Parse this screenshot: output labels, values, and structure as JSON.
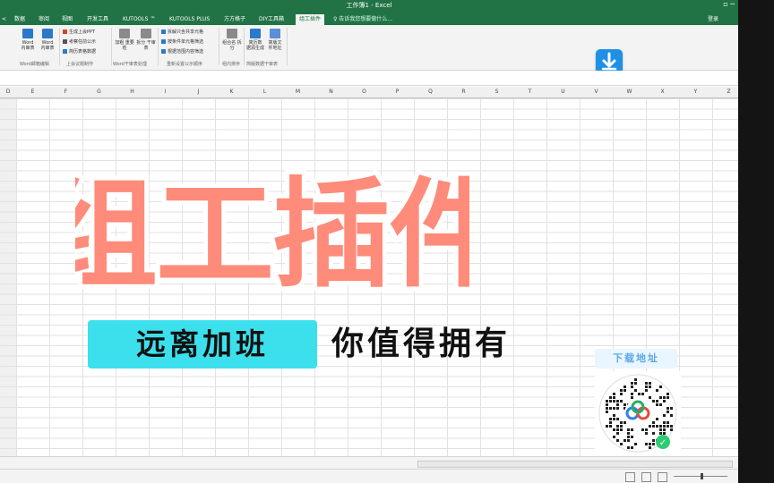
{
  "window": {
    "title": "工作簿1 - Excel",
    "controls": "▫  ─"
  },
  "tabs": [
    "数据",
    "审阅",
    "视图",
    "开发工具",
    "KUTOOLS ™",
    "KUTOOLS PLUS",
    "方方格子",
    "DIY工具箱",
    "组工插件"
  ],
  "tabs_active_index": 8,
  "tell_me": "♀ 告诉我您想要做什么...",
  "sign_in": "登录",
  "ribbon": {
    "groups": [
      {
        "label": "Word邮箱编辑"
      },
      {
        "label": "上会议题制作"
      },
      {
        "label": "Word干审表处理"
      },
      {
        "label": "重新设置公示顺序"
      },
      {
        "label": "组内排序"
      },
      {
        "label": "简版数据干审表"
      }
    ],
    "buttons": [
      {
        "label": "Word 内审表"
      },
      {
        "label": "Word 内审表"
      },
      {
        "label": "加粗 重要姓"
      },
      {
        "label": "拆分 干审表"
      },
      {
        "label": "组合名 拆分"
      },
      {
        "label": "简历数 据源生成"
      },
      {
        "label": "简版文 件地址"
      }
    ],
    "small_items": [
      "生成上会PPT",
      "考察任前公示",
      "简历表格数据",
      "拆解只含共享元格",
      "按条件单元格筛选",
      "根据范围内容筛选"
    ]
  },
  "columns": [
    "D",
    "E",
    "F",
    "G",
    "H",
    "I",
    "J",
    "K",
    "L",
    "M",
    "N",
    "O",
    "P",
    "Q",
    "R",
    "S",
    "T",
    "U",
    "V",
    "W",
    "X",
    "Y",
    "Z"
  ],
  "overlay": {
    "headline": "组工插件",
    "slogan_left": "远离加班",
    "slogan_right": "你值得拥有",
    "download_label": "下载地址"
  },
  "colors": {
    "excel_green": "#217346",
    "headline_fill": "#ff8b7a",
    "pill_bg": "#3be0ec",
    "download_icon": "#1e90e6"
  },
  "icons": [
    "download-arrow-icon",
    "qr-code",
    "baidu-cloud-icon"
  ]
}
